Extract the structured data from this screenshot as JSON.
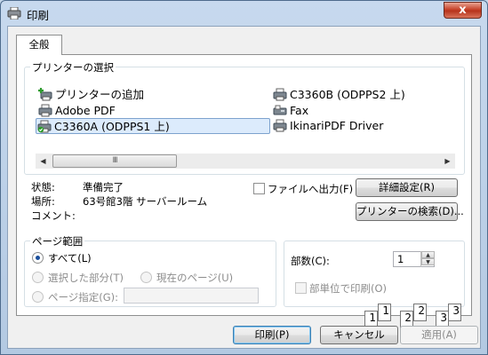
{
  "window": {
    "title": "印刷",
    "close_glyph": "x"
  },
  "tabs": [
    {
      "label": "全般"
    }
  ],
  "printer_select": {
    "group_label": "プリンターの選択",
    "printers": [
      {
        "label": "プリンターの追加",
        "icon": "add-printer-icon",
        "selected": false
      },
      {
        "label": "Adobe PDF",
        "icon": "printer-icon",
        "selected": false
      },
      {
        "label": "C3360A (ODPPS1 上)",
        "icon": "printer-icon",
        "selected": true
      },
      {
        "label": "C3360B (ODPPS2 上)",
        "icon": "printer-icon",
        "selected": false
      },
      {
        "label": "Fax",
        "icon": "fax-icon",
        "selected": false
      },
      {
        "label": "IkinariPDF Driver",
        "icon": "printer-icon",
        "selected": false
      }
    ],
    "scroll_left": "◀",
    "scroll_right": "▶",
    "scroll_grip": "III"
  },
  "printer_info": {
    "status_label": "状態:",
    "status_value": "準備完了",
    "location_label": "場所:",
    "location_value": "63号館3階 サーバールーム",
    "comment_label": "コメント:",
    "comment_value": "",
    "print_to_file_label": "ファイルへ出力(F)",
    "print_to_file_checked": false,
    "details_button": "詳細設定(R)",
    "find_printer_button": "プリンターの検索(D)..."
  },
  "page_range": {
    "group_label": "ページ範囲",
    "all_label": "すべて(L)",
    "selection_label": "選択した部分(T)",
    "current_page_label": "現在のページ(U)",
    "pages_label": "ページ指定(G):",
    "pages_value": "",
    "selected_option": "all"
  },
  "copies": {
    "count_label": "部数(C):",
    "count_value": "1",
    "collate_label": "部単位で印刷(O)",
    "collate_checked": false,
    "preview_sheets": [
      "1",
      "1",
      "2",
      "2",
      "3",
      "3"
    ]
  },
  "footer": {
    "print_button": "印刷(P)",
    "cancel_button": "キャンセル",
    "apply_button": "適用(A)"
  }
}
